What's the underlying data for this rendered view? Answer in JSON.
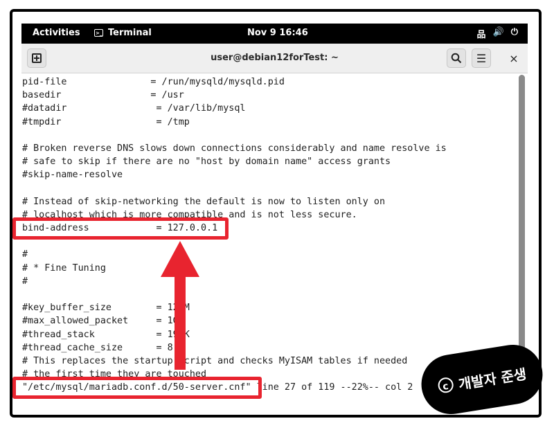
{
  "topbar": {
    "activities": "Activities",
    "app_name": "Terminal",
    "app_icon": ">_",
    "clock": "Nov 9  16:46",
    "network_icon": "品",
    "volume_icon": "🔊",
    "power_icon": "⏻"
  },
  "window": {
    "title": "user@debian12forTest: ~",
    "search_icon": "🔍",
    "menu_icon": "☰",
    "close_icon": "×"
  },
  "terminal": {
    "lines": [
      "pid-file               = /run/mysqld/mysqld.pid",
      "basedir                = /usr",
      "#datadir                = /var/lib/mysql",
      "#tmpdir                 = /tmp",
      "",
      "# Broken reverse DNS slows down connections considerably and name resolve is",
      "# safe to skip if there are no \"host by domain name\" access grants",
      "#skip-name-resolve",
      "",
      "# Instead of skip-networking the default is now to listen only on",
      "# localhost which is more compatible and is not less secure.",
      "bind-address            = 127.0.0.1",
      "",
      "#",
      "# * Fine Tuning",
      "#",
      "",
      "#key_buffer_size        = 128M",
      "#max_allowed_packet     = 1G",
      "#thread_stack           = 192K",
      "#thread_cache_size      = 8",
      "# This replaces the startup script and checks MyISAM tables if needed",
      "# the first time they are touched",
      "\"/etc/mysql/mariadb.conf.d/50-server.cnf\" line 27 of 119 --22%-- col 2"
    ]
  },
  "watermark": {
    "text": "개발자 준생",
    "symbol": "c"
  },
  "colors": {
    "highlight": "#e8242f",
    "topbar_bg": "#000000",
    "titlebar_bg": "#efefef"
  }
}
